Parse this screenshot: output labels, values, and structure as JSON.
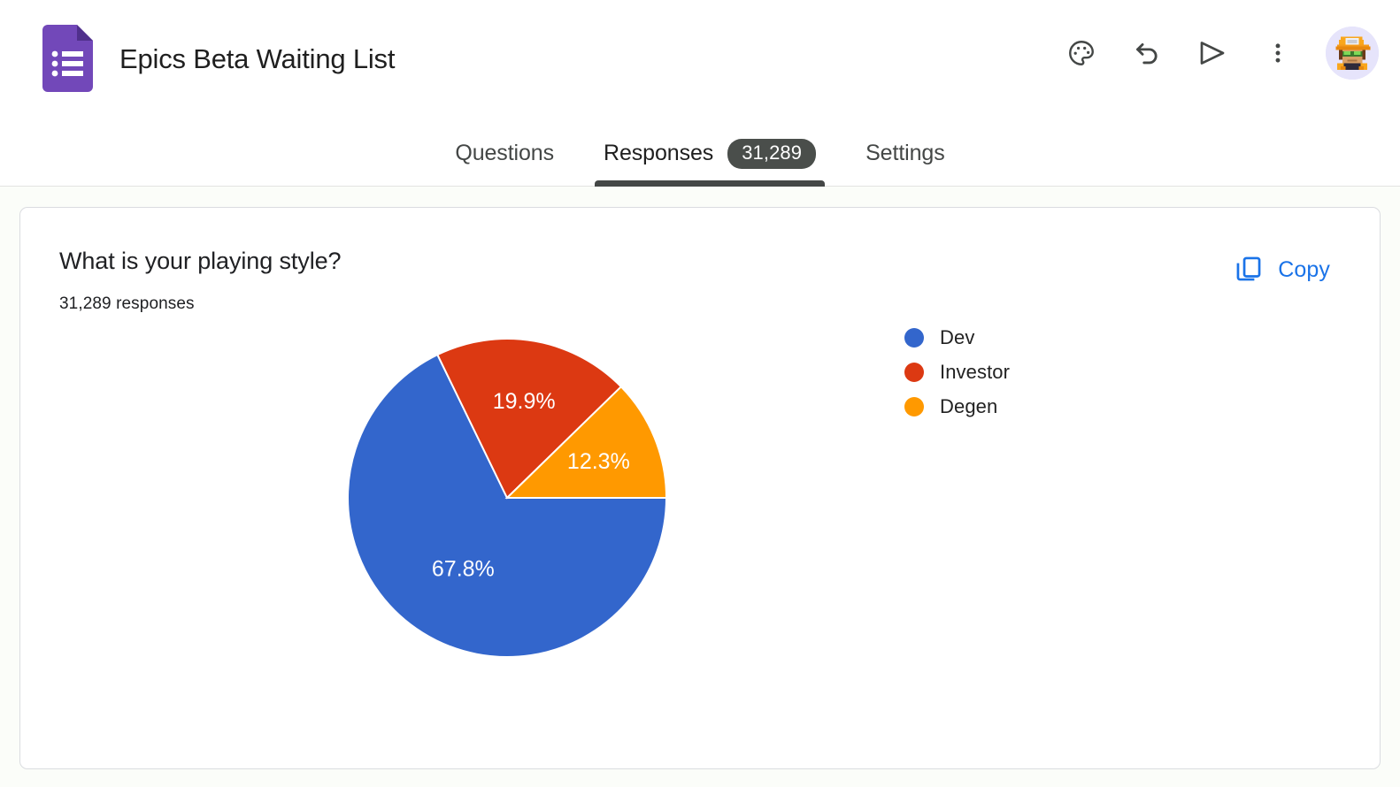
{
  "app": {
    "product_icon": "google-forms-icon",
    "document_title": "Epics Beta Waiting List"
  },
  "toolbar": {
    "theme_label": "Customize theme",
    "undo_label": "Undo",
    "send_label": "Send",
    "more_label": "More options",
    "account_label": "Google Account",
    "icons": [
      "palette-icon",
      "undo-icon",
      "send-icon",
      "more-vert-icon",
      "avatar"
    ]
  },
  "tabs": [
    {
      "label": "Questions",
      "active": false,
      "badge": null
    },
    {
      "label": "Responses",
      "active": true,
      "badge": "31,289"
    },
    {
      "label": "Settings",
      "active": false,
      "badge": null
    }
  ],
  "question_card": {
    "title": "What is your playing style?",
    "response_count": "31,289 responses",
    "copy_label": "Copy",
    "copy_icon": "copy-icon"
  },
  "colors": {
    "dev": "#3366cc",
    "investor": "#dc3912",
    "degen": "#ff9900",
    "accent_blue": "#1a73e8",
    "badge_dark": "#4a4e4b",
    "forms_purple": "#7248b9"
  },
  "chart_data": {
    "type": "pie",
    "title": "What is your playing style?",
    "subtitle": "31,289 responses",
    "total_responses": 31289,
    "categories": [
      "Dev",
      "Investor",
      "Degen"
    ],
    "values": [
      67.8,
      19.9,
      12.3
    ],
    "value_unit": "percent",
    "data_labels": [
      "67.8%",
      "19.9%",
      "12.3%"
    ],
    "colors": [
      "#3366cc",
      "#dc3912",
      "#ff9900"
    ],
    "legend": [
      "Dev",
      "Investor",
      "Degen"
    ],
    "legend_position": "right",
    "start_angle_deg": 0,
    "direction": "clockwise",
    "grid": false
  }
}
